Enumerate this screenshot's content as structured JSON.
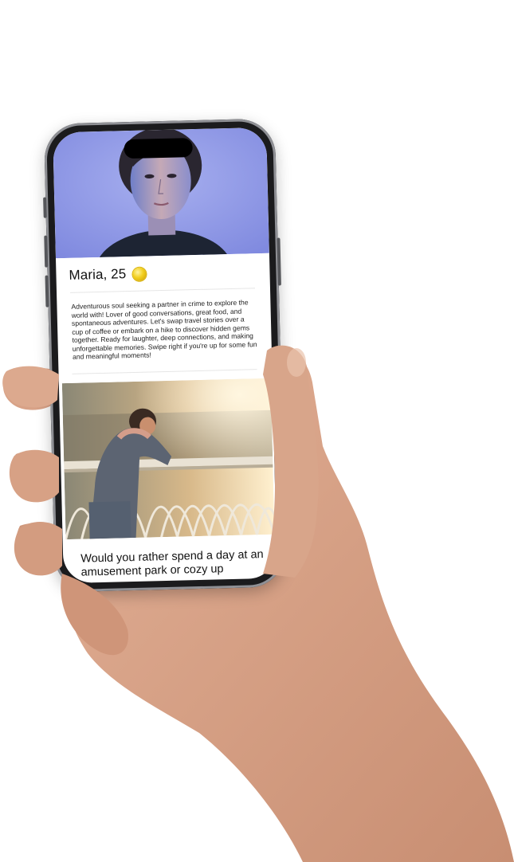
{
  "profile": {
    "name_age": "Maria, 25",
    "badge_icon": "gold-coin-icon",
    "bio": "Adventurous soul seeking a partner in crime to explore the world with! Lover of good conversations, great food, and spontaneous adventures. Let's swap travel stories over a cup of coffee or embark on a hike to discover hidden gems together. Ready for laughter, deep connections, and making unforgettable memories. Swipe right if you're up for some fun and meaningful moments!"
  },
  "prompt": {
    "question": "Would you rather spend a day at an amusement park or cozy up"
  },
  "colors": {
    "hero_bg": "#8e98e8",
    "badge": "#f2cf1f",
    "phone_frame": "#1b1b1d",
    "skin": "#d9a488"
  }
}
